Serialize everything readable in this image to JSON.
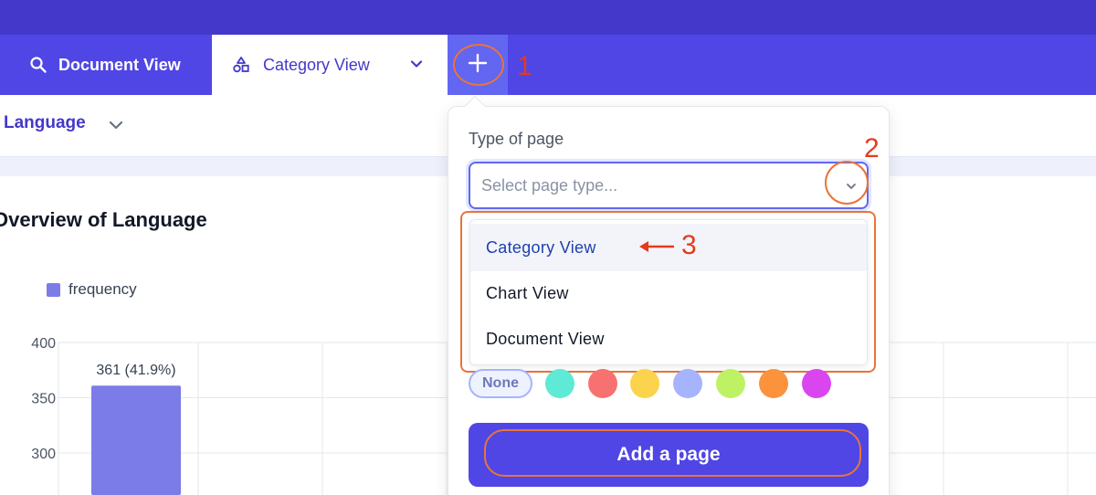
{
  "tabs": {
    "document_view": "Document View",
    "category_view": "Category View",
    "add_icon": "plus-icon"
  },
  "annotations": {
    "step1": "1",
    "step2": "2",
    "step3": "3"
  },
  "subheader": {
    "field_label": "Language"
  },
  "chart": {
    "title": "Overview of Language",
    "legend": "frequency"
  },
  "popup": {
    "type_label": "Type of page",
    "select_placeholder": "Select page type...",
    "options": [
      "Category View",
      "Chart View",
      "Document View"
    ],
    "color_none_label": "None",
    "colors": [
      "#5eead4",
      "#f87171",
      "#fcd34d",
      "#a5b4fc",
      "#bef264",
      "#fb923c",
      "#d946ef"
    ],
    "add_button": "Add a page"
  },
  "chart_data": {
    "type": "bar",
    "title": "Overview of Language",
    "series": [
      {
        "name": "frequency",
        "values": [
          361
        ]
      }
    ],
    "data_labels": [
      "361 (41.9%)"
    ],
    "y_ticks": [
      300,
      350,
      400
    ],
    "ylim": [
      280,
      400
    ],
    "grid": true,
    "legend_position": "top-left",
    "colors": {
      "bar": "#7b7ce8"
    }
  }
}
